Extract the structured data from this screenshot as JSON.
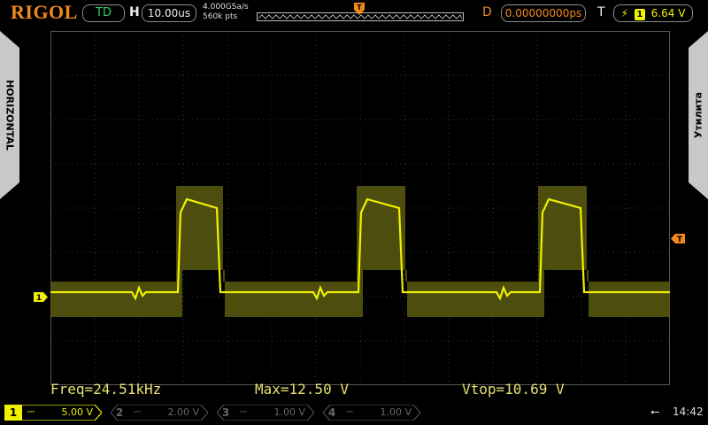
{
  "header": {
    "brand": "RIGOL",
    "trigger_status": "TD",
    "horizontal_label": "H",
    "timebase": "10.00us",
    "sample_rate": "4.000GSa/s",
    "memory_depth": "560k pts",
    "delay_label": "D",
    "delay_value": "0.00000000ps",
    "trigger_label": "T",
    "trigger_source": "1",
    "trigger_level": "6.64 V"
  },
  "side_tabs": {
    "left": "HORIZONTAL",
    "right": "Утилита"
  },
  "markers": {
    "trigger_position": "T",
    "trigger_level_marker": "T",
    "channel1_ground": "1"
  },
  "measurements": [
    {
      "text": "Freq=24.51kHz"
    },
    {
      "text": "Max=12.50 V"
    },
    {
      "text": "Vtop=10.69 V"
    }
  ],
  "channels": [
    {
      "num": "1",
      "coupling": "⎓",
      "scale": "5.00 V",
      "active": true
    },
    {
      "num": "2",
      "coupling": "⎓",
      "scale": "2.00 V",
      "active": false
    },
    {
      "num": "3",
      "coupling": "⎓",
      "scale": "1.00 V",
      "active": false
    },
    {
      "num": "4",
      "coupling": "⎓",
      "scale": "1.00 V",
      "active": false
    }
  ],
  "status": {
    "usb_icon": "usb-icon",
    "clock": "14:42"
  },
  "colors": {
    "brand": "#f08a1a",
    "trigger_status": "#30d060",
    "channel1": "#f0f000",
    "channel2": "#00e0ff",
    "channel3": "#ff00ff",
    "channel4": "#3080ff",
    "grid": "#3a3a3a"
  }
}
